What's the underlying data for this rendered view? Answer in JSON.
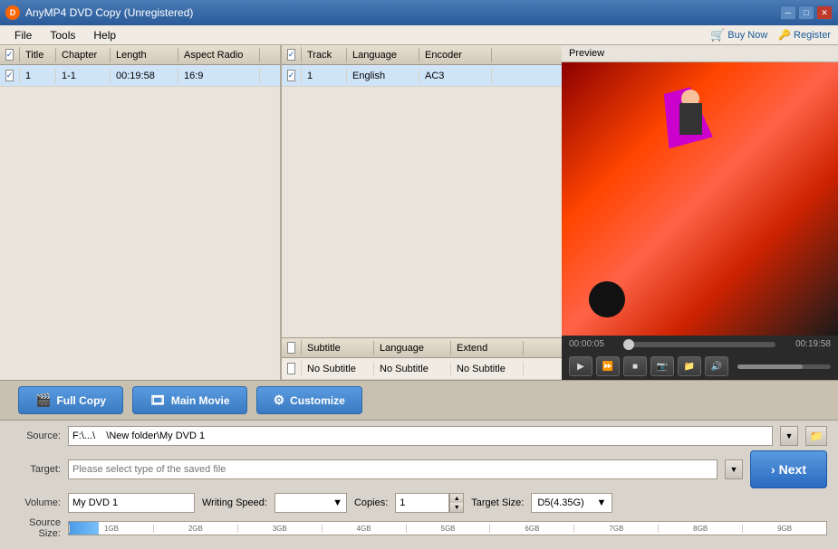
{
  "titleBar": {
    "title": "AnyMP4 DVD Copy (Unregistered)",
    "icon": "D",
    "controls": [
      "minimize",
      "maximize",
      "close"
    ]
  },
  "menuBar": {
    "items": [
      "File",
      "Tools",
      "Help"
    ],
    "buyLabel": "Buy Now",
    "registerLabel": "Register"
  },
  "videoTable": {
    "headers": {
      "check": "",
      "title": "Title",
      "chapter": "Chapter",
      "length": "Length",
      "aspectRatio": "Aspect Radio"
    },
    "rows": [
      {
        "checked": true,
        "title": "1",
        "chapter": "1-1",
        "length": "00:19:58",
        "aspectRatio": "16:9"
      }
    ]
  },
  "trackTable": {
    "headers": {
      "check": "",
      "track": "Track",
      "language": "Language",
      "encoder": "Encoder"
    },
    "rows": [
      {
        "checked": true,
        "track": "1",
        "language": "English",
        "encoder": "AC3"
      }
    ]
  },
  "subtitleTable": {
    "headers": {
      "check": "",
      "subtitle": "Subtitle",
      "language": "Language",
      "extend": "Extend"
    },
    "rows": [
      {
        "checked": false,
        "subtitle": "No Subtitle",
        "language": "No Subtitle",
        "extend": "No Subtitle"
      }
    ]
  },
  "preview": {
    "label": "Preview",
    "currentTime": "00:00:05",
    "totalTime": "00:19:58"
  },
  "copyModes": {
    "fullCopy": "Full Copy",
    "mainMovie": "Main Movie",
    "customize": "Customize"
  },
  "bottomPanel": {
    "sourceLabel": "Source:",
    "sourceValue": "F:\\...\\    \\New folder\\My DVD 1",
    "targetLabel": "Target:",
    "targetPlaceholder": "Please select type of the saved file",
    "volumeLabel": "Volume:",
    "volumeValue": "My DVD 1",
    "writingSpeedLabel": "Writing Speed:",
    "writingSpeedValue": "",
    "copiesLabel": "Copies:",
    "copiesValue": "1",
    "targetSizeLabel": "Target Size:",
    "targetSizeValue": "D5(4.35G)",
    "sourceSizeLabel": "Source Size:",
    "sizeMarkers": [
      "1GB",
      "2GB",
      "3GB",
      "4GB",
      "5GB",
      "6GB",
      "7GB",
      "8GB",
      "9GB"
    ],
    "nextLabel": "Next"
  }
}
